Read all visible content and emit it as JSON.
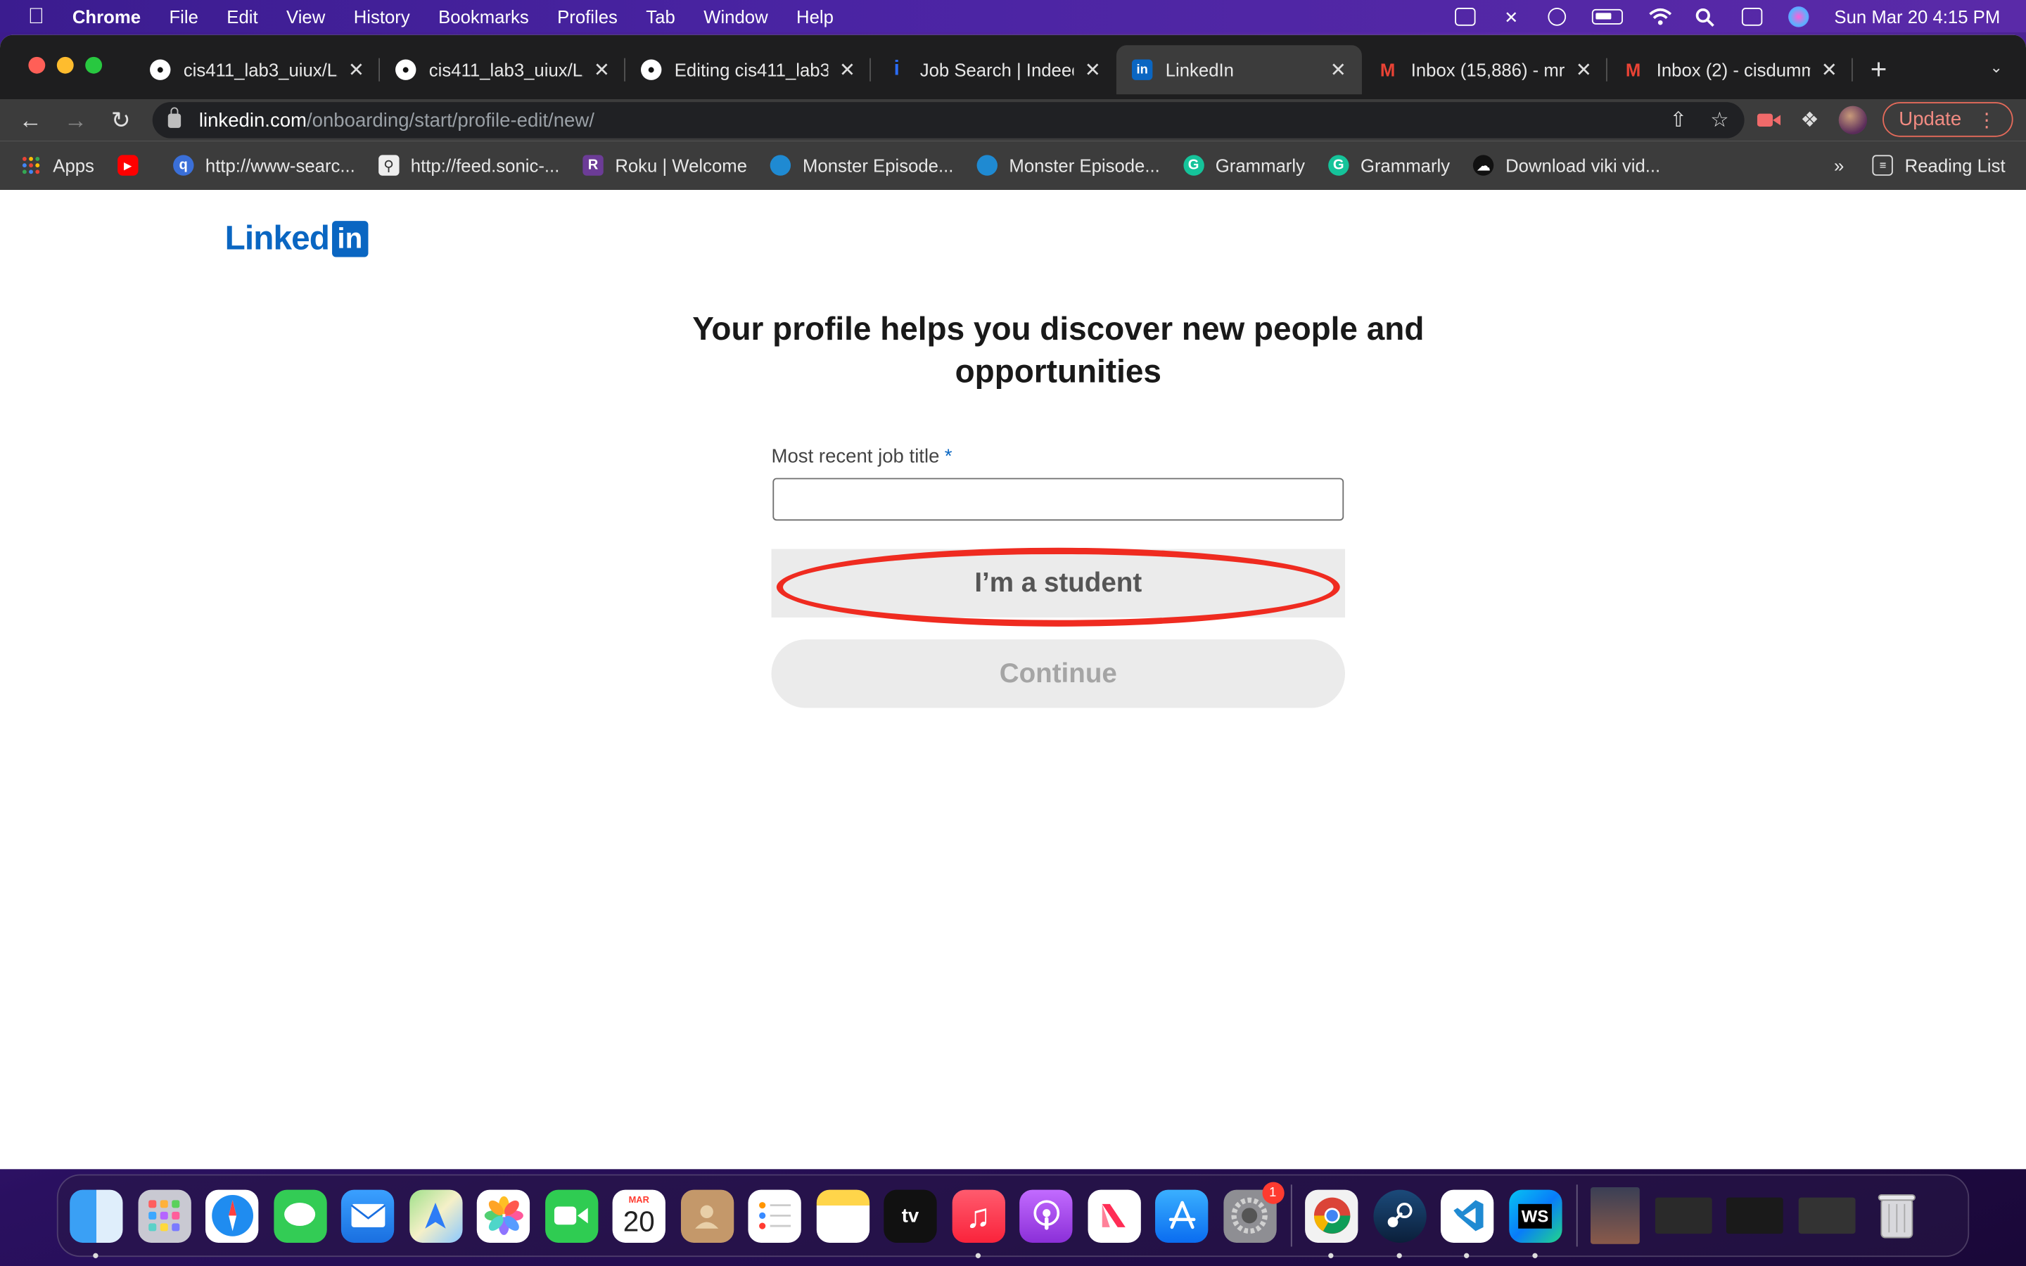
{
  "menubar": {
    "app_name": "Chrome",
    "items": [
      "File",
      "Edit",
      "View",
      "History",
      "Bookmarks",
      "Profiles",
      "Tab",
      "Window",
      "Help"
    ],
    "clock": "Sun Mar 20  4:15 PM"
  },
  "tabs": [
    {
      "label": "cis411_lab3_uiux/L/",
      "icon": "github-icon",
      "active": false
    },
    {
      "label": "cis411_lab3_uiux/L/",
      "icon": "github-icon",
      "active": false
    },
    {
      "label": "Editing cis411_lab3",
      "icon": "github-icon",
      "active": false
    },
    {
      "label": "Job Search | Indeed",
      "icon": "indeed-icon",
      "active": false
    },
    {
      "label": "LinkedIn",
      "icon": "linkedin-icon",
      "active": true
    },
    {
      "label": "Inbox (15,886) - mr",
      "icon": "gmail-icon",
      "active": false
    },
    {
      "label": "Inbox (2) - cisdumm",
      "icon": "gmail-icon",
      "active": false
    }
  ],
  "omnibox": {
    "host": "linkedin.com",
    "path": "/onboarding/start/profile-edit/new/"
  },
  "toolbar": {
    "update_label": "Update"
  },
  "bookmarks": {
    "items": [
      {
        "label": "Apps",
        "icon": "apps-grid-icon"
      },
      {
        "label": "",
        "icon": "youtube-icon"
      },
      {
        "label": "http://www-searc...",
        "icon": "search-globe-icon"
      },
      {
        "label": "http://feed.sonic-...",
        "icon": "magnifier-page-icon"
      },
      {
        "label": "Roku | Welcome",
        "icon": "roku-icon"
      },
      {
        "label": "Monster Episode...",
        "icon": "att-icon"
      },
      {
        "label": "Monster Episode...",
        "icon": "att-icon"
      },
      {
        "label": "Grammarly",
        "icon": "grammarly-icon"
      },
      {
        "label": "Grammarly",
        "icon": "grammarly-icon"
      },
      {
        "label": "Download viki vid...",
        "icon": "cloud-icon"
      }
    ],
    "overflow": "»",
    "reading_list": "Reading List"
  },
  "page": {
    "logo_word": "Linked",
    "logo_box": "in",
    "headline": "Your profile helps you discover new people and opportunities",
    "job_title_label": "Most recent job title",
    "required_mark": "*",
    "job_title_value": "",
    "student_button": "I’m a student",
    "continue_button": "Continue"
  },
  "dock": {
    "apps": [
      "finder-icon",
      "launchpad-icon",
      "safari-icon",
      "messages-icon",
      "mail-icon",
      "maps-icon",
      "photos-icon",
      "facetime-icon",
      "calendar-icon",
      "contacts-icon",
      "reminders-icon",
      "notes-icon",
      "apple-tv-icon",
      "music-icon",
      "podcasts-icon",
      "news-icon",
      "app-store-icon",
      "system-preferences-icon",
      "chrome-icon",
      "steam-icon",
      "vscode-icon",
      "webstorm-icon",
      "photo-thumb-icon",
      "window-thumb-icon",
      "window-thumb-icon",
      "window-thumb-icon",
      "trash-icon"
    ],
    "calendar_month": "MAR",
    "calendar_day": "20",
    "tv_label": "tv",
    "prefs_badge": "1",
    "webstorm_label": "WS"
  }
}
